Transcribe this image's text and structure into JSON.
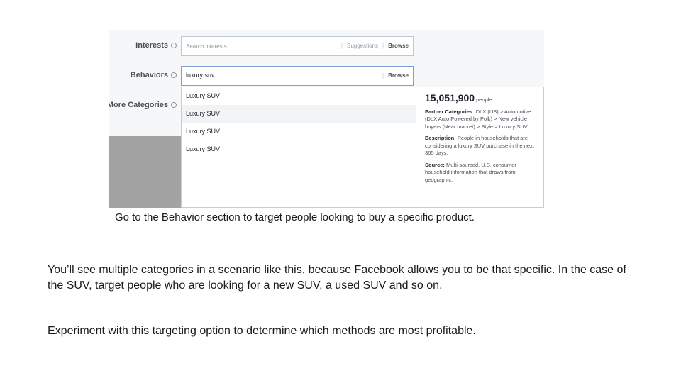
{
  "screenshot": {
    "rows": {
      "interests_label": "Interests",
      "behaviors_label": "Behaviors",
      "more_categories_label": "More Categories"
    },
    "interests_field": {
      "placeholder": "Search interests",
      "suggestions_link": "Suggestions",
      "browse_link": "Browse"
    },
    "behaviors_field": {
      "value": "luxury suv",
      "browse_link": "Browse"
    },
    "dropdown": {
      "items": [
        "Luxury SUV",
        "Luxury SUV",
        "Luxury SUV",
        "Luxury SUV"
      ],
      "active_index": 1
    },
    "detail": {
      "audience_count": "15,051,900",
      "audience_unit": "people",
      "partner_categories_label": "Partner Categories:",
      "partner_categories_value": "DLX (US) > Automotive (DLX Auto Powered by Polk) > New vehicle buyers (Near market) > Style > Luxury SUV",
      "description_label": "Description:",
      "description_value": "People in households that are considering a luxury SUV purchase in the next 365 days.",
      "source_label": "Source:",
      "source_value": "Multi-sourced, U.S. consumer household information that draws from geographic,"
    }
  },
  "caption": "Go to the Behavior section to target people looking to buy a specific product.",
  "paragraphs": [
    "You’ll see multiple categories in a scenario like this, because Facebook allows you to be that specific. In the case of the SUV, target people who are looking for a new SUV, a used SUV and so on.",
    "Experiment with this targeting option to determine which methods are most profitable."
  ]
}
